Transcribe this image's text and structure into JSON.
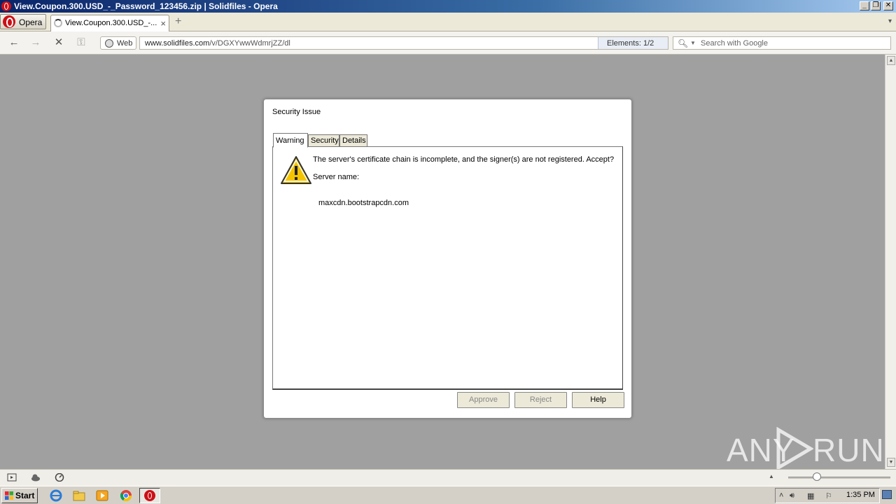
{
  "window": {
    "title": "View.Coupon.300.USD_-_Password_123456.zip | Solidfiles - Opera",
    "controls": [
      "_",
      "❐",
      "✕"
    ]
  },
  "tabbar": {
    "menu_label": "Opera",
    "tab_label": "View.Coupon.300.USD_-...",
    "close_glyph": "×",
    "new_tab_glyph": "+",
    "tab_menu_glyph": "▾"
  },
  "navbar": {
    "back_glyph": "←",
    "forward_glyph": "→",
    "stop_glyph": "✕",
    "key_glyph": "⚿",
    "web_label": "Web",
    "url_host": "www.solidfiles.com",
    "url_path": "/v/DGXYwwWdmrjZZ/dl",
    "elements_text": "Elements:  1/2",
    "search_placeholder": "Search with Google"
  },
  "dialog": {
    "title": "Security Issue",
    "tabs": [
      {
        "label": "Warning"
      },
      {
        "label": "Security"
      },
      {
        "label": "Details"
      }
    ],
    "message": "The server's certificate chain is incomplete, and the signer(s) are not registered. Accept?",
    "server_label": "Server name:",
    "server_value": "maxcdn.bootstrapcdn.com",
    "buttons": {
      "approve": "Approve",
      "reject": "Reject",
      "help": "Help"
    }
  },
  "taskbar": {
    "start_label": "Start",
    "clock": "1:35 PM"
  },
  "watermark": {
    "left": "ANY",
    "right": "RUN"
  },
  "colors": {
    "content_bg": "#a0a0a0",
    "opera_red": "#cc0f16",
    "warning_yellow": "#f5c400"
  }
}
